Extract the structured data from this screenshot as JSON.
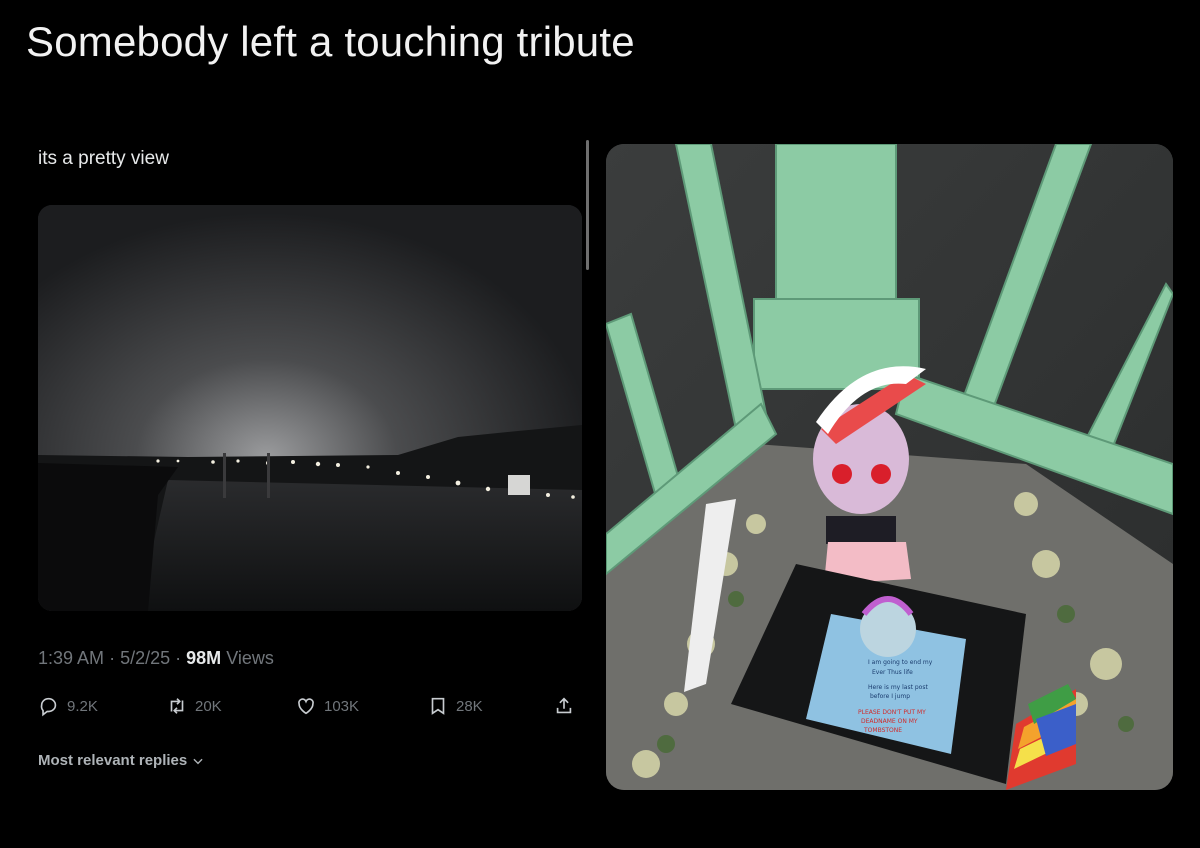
{
  "headline": "Somebody left a touching tribute",
  "post": {
    "text": "its a pretty view",
    "time": "1:39 AM",
    "separator": "·",
    "date": "5/2/25",
    "views_count": "98M",
    "views_label": "Views",
    "actions": {
      "replies": "9.2K",
      "reposts": "20K",
      "likes": "103K",
      "bookmarks": "28K"
    },
    "replies_sort": "Most relevant replies"
  },
  "icons": {
    "reply": "speech-bubble-icon",
    "repost": "repost-arrows-icon",
    "like": "heart-icon",
    "bookmark": "bookmark-icon",
    "share": "share-upload-icon",
    "chevron": "chevron-down-icon"
  },
  "colors": {
    "background": "#000000",
    "text_primary": "#e7e9ea",
    "text_secondary": "#71767b",
    "railing": "#8ccba4"
  },
  "tribute_sign": {
    "lines": [
      "I am going to end my",
      "Ever Thus life",
      "Here is my last post",
      "before I jump",
      "PLEASE DON'T PUT MY",
      "DEADNAME ON MY",
      "TOMBSTONE"
    ]
  }
}
